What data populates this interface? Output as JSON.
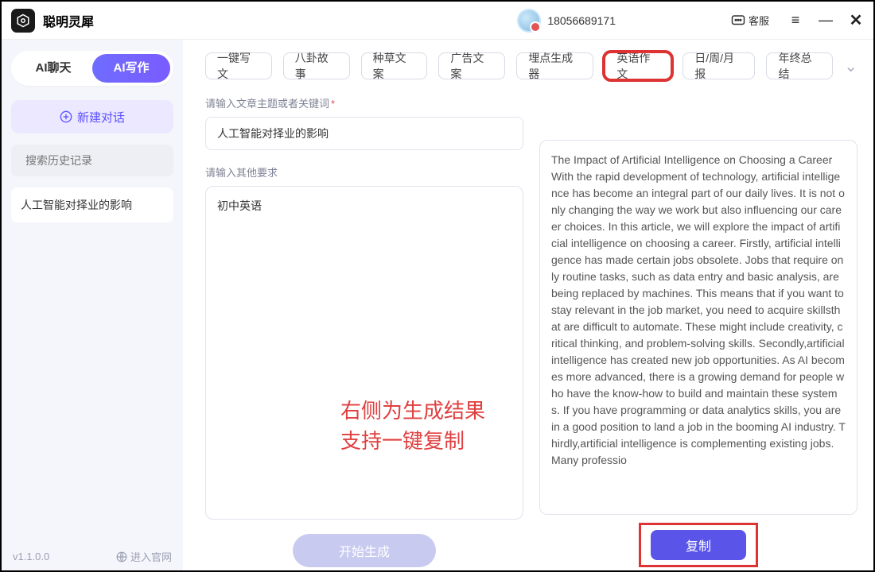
{
  "header": {
    "app_name": "聪明灵犀",
    "phone": "18056689171",
    "service_label": "客服"
  },
  "sidebar": {
    "tab_chat": "AI聊天",
    "tab_write": "AI写作",
    "new_chat": "新建对话",
    "search_placeholder": "搜索历史记录",
    "history": [
      "人工智能对择业的影响"
    ],
    "version": "v1.1.0.0",
    "enter_site": "进入官网"
  },
  "pills": {
    "items": [
      "一键写文",
      "八卦故事",
      "种草文案",
      "广告文案",
      "埋点生成器",
      "英语作文",
      "日/周/月报",
      "年终总结"
    ],
    "highlight_index": 5
  },
  "form": {
    "topic_label": "请输入文章主题或者关键词",
    "topic_value": "人工智能对择业的影响",
    "extra_label": "请输入其他要求",
    "extra_value": "初中英语",
    "generate_btn": "开始生成"
  },
  "overlay": {
    "line1": "右侧为生成结果",
    "line2": "支持一键复制"
  },
  "result": {
    "text": "The Impact of Artificial Intelligence on Choosing a Career With the rapid development of technology, artificial intelligence has become an integral part of our daily lives. It is not only changing the way we work but also influencing our career choices. In this article, we will explore the impact of artificial intelligence on choosing a career. Firstly, artificial intelligence has made certain jobs obsolete. Jobs that require only routine tasks, such as data entry and basic analysis, are being replaced by machines. This means that if you want to stay relevant in the job market, you need to acquire skillsthat are difficult to automate. These might include creativity, critical thinking, and problem-solving skills. Secondly,artificial intelligence has created new job opportunities. As AI becomes more advanced, there is a growing demand for people who have the know-how to build and maintain these systems. If you have programming or data analytics skills, you are in a good position to land a job in the booming AI industry. Thirdly,artificial intelligence is complementing existing jobs. Many professio",
    "copy_btn": "复制"
  }
}
